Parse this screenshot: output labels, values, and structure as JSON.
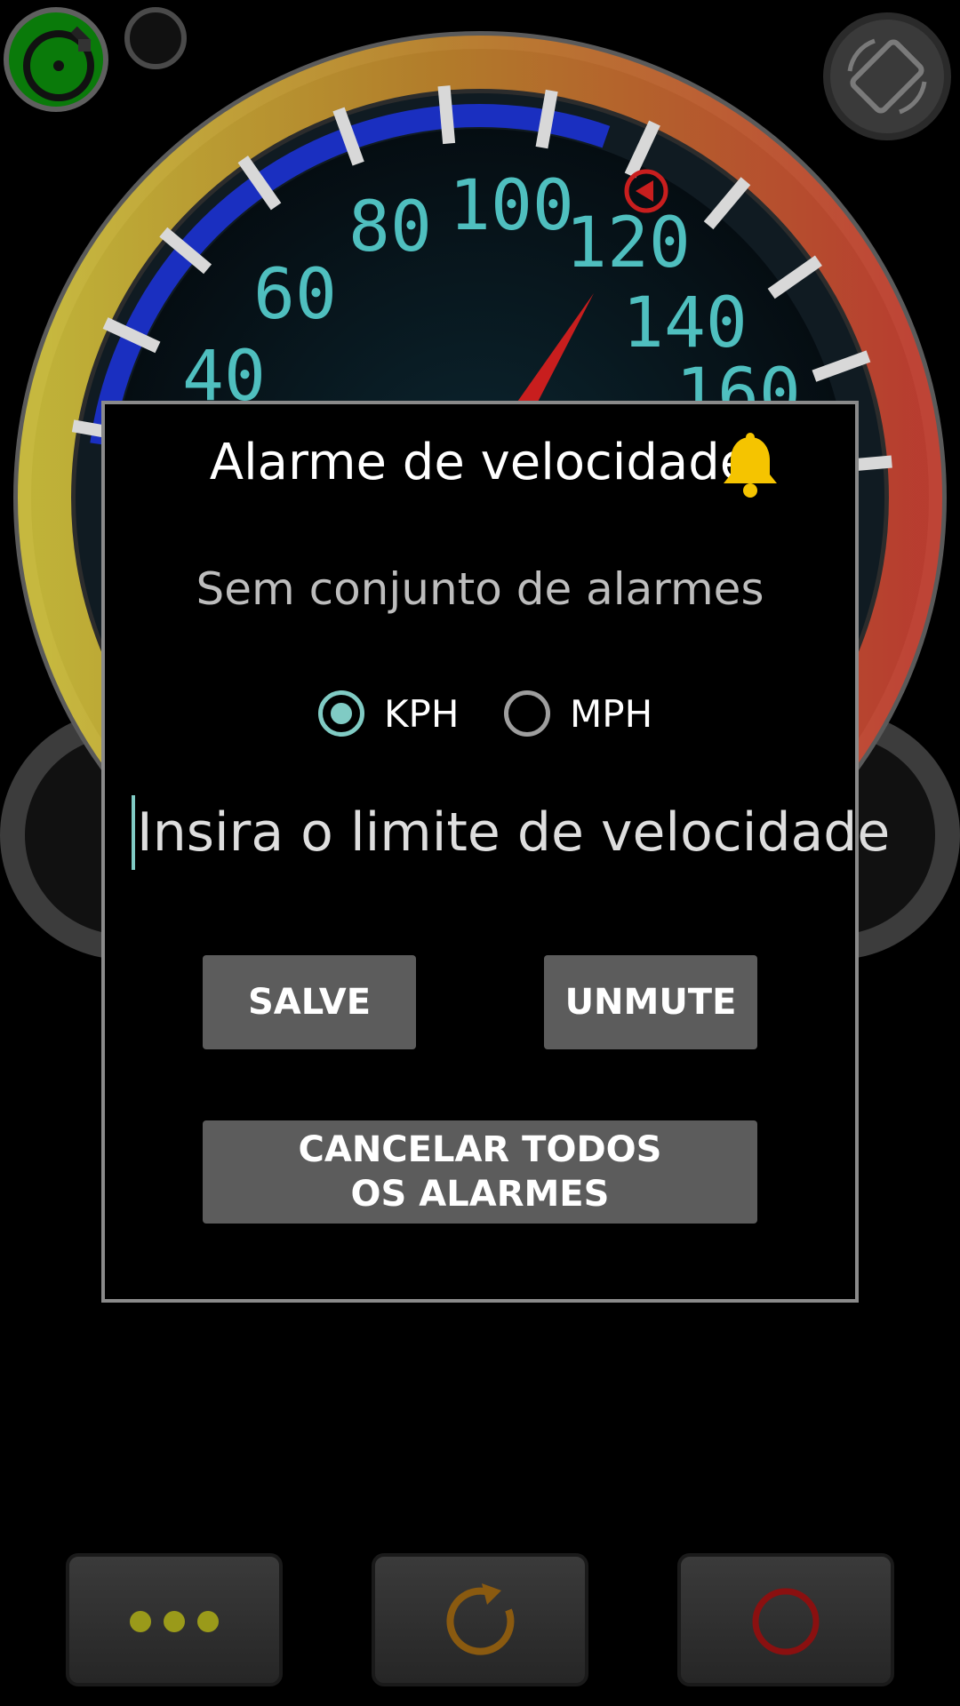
{
  "gauge": {
    "speed_labels": [
      "40",
      "60",
      "80",
      "100",
      "120",
      "140",
      "160"
    ]
  },
  "dialog": {
    "title": "Alarme de velocidade",
    "bell_icon": "bell-icon",
    "status": "Sem conjunto de alarmes",
    "units": [
      {
        "label": "KPH",
        "selected": true
      },
      {
        "label": "MPH",
        "selected": false
      }
    ],
    "input": {
      "placeholder": "Insira o limite de velocidade",
      "value": ""
    },
    "save_label": "SALVE",
    "unmute_label": "UNMUTE",
    "cancel_all_label": "CANCELAR TODOS OS ALARMES"
  },
  "colors": {
    "accent": "#80cbc4",
    "bell": "#f5c400",
    "gps_active": "#0a7a0a",
    "dots": "#9a9a1a",
    "refresh": "#8a5a10",
    "stop": "#8a1010",
    "gauge_blue": "#1a2fc0",
    "gauge_digits": "#4fbfbf"
  },
  "bottom_bar": {
    "icons": [
      "more-dots-icon",
      "refresh-icon",
      "stop-circle-icon"
    ]
  }
}
